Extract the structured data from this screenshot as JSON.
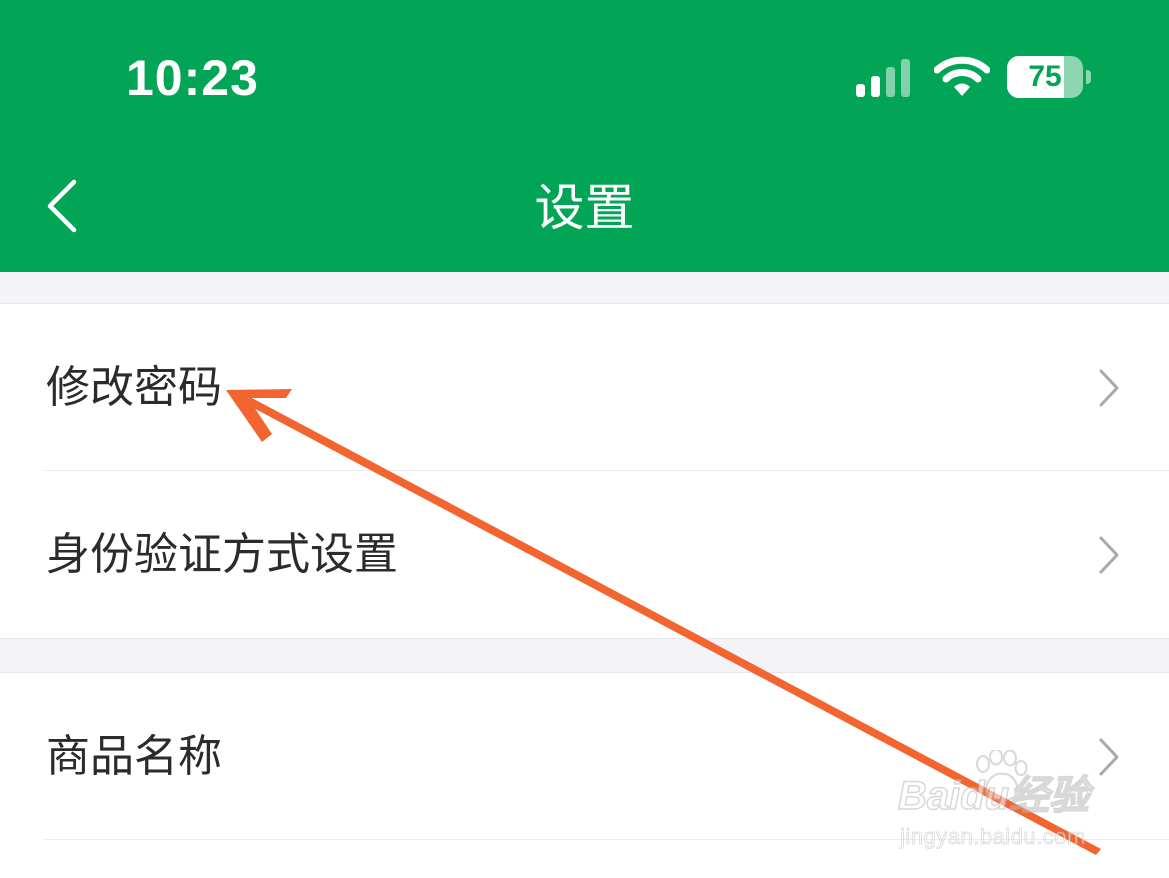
{
  "status_bar": {
    "time": "10:23",
    "battery_level": "75",
    "battery_fraction": 0.75
  },
  "nav": {
    "title": "设置",
    "back_icon": "chevron-left-icon"
  },
  "settings_groups": [
    {
      "items": [
        {
          "label": "修改密码"
        },
        {
          "label": "身份验证方式设置"
        }
      ]
    },
    {
      "items": [
        {
          "label": "商品名称"
        }
      ]
    }
  ],
  "watermark": {
    "brand": "Baidu经验",
    "url": "jingyan.baidu.com"
  },
  "colors": {
    "header_green": "#02a555",
    "annotation_arrow": "#f26430",
    "page_background": "#f4f4f6"
  }
}
